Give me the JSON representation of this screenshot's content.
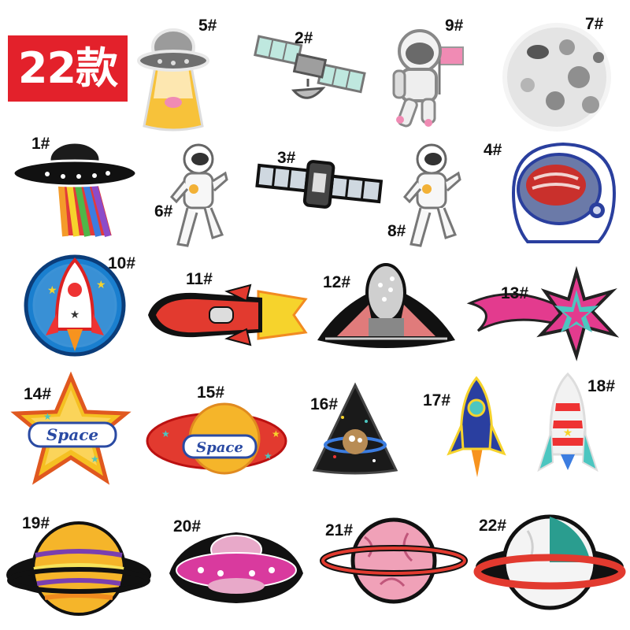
{
  "badge": {
    "text": "22款"
  },
  "patches": [
    {
      "id": "1",
      "label": "1#",
      "icon": "ufo-rainbow-beam"
    },
    {
      "id": "2",
      "label": "2#",
      "icon": "satellite-teal"
    },
    {
      "id": "3",
      "label": "3#",
      "icon": "satellite-dark"
    },
    {
      "id": "4",
      "label": "4#",
      "icon": "astronaut-helmet"
    },
    {
      "id": "5",
      "label": "5#",
      "icon": "ufo-beam-pig"
    },
    {
      "id": "6",
      "label": "6#",
      "icon": "astronaut-floating"
    },
    {
      "id": "7",
      "label": "7#",
      "icon": "moon"
    },
    {
      "id": "8",
      "label": "8#",
      "icon": "astronaut-floating"
    },
    {
      "id": "9",
      "label": "9#",
      "icon": "astronaut-flag"
    },
    {
      "id": "10",
      "label": "10#",
      "icon": "rocket-circle"
    },
    {
      "id": "11",
      "label": "11#",
      "icon": "red-rocket-flying"
    },
    {
      "id": "12",
      "label": "12#",
      "icon": "sequin-spaceship"
    },
    {
      "id": "13",
      "label": "13#",
      "icon": "shooting-star"
    },
    {
      "id": "14",
      "label": "14#",
      "icon": "star-space",
      "text": "Space"
    },
    {
      "id": "15",
      "label": "15#",
      "icon": "planet-space",
      "text": "Space"
    },
    {
      "id": "16",
      "label": "16#",
      "icon": "triangle-planet"
    },
    {
      "id": "17",
      "label": "17#",
      "icon": "blue-rocket"
    },
    {
      "id": "18",
      "label": "18#",
      "icon": "striped-rocket"
    },
    {
      "id": "19",
      "label": "19#",
      "icon": "striped-saturn"
    },
    {
      "id": "20",
      "label": "20#",
      "icon": "pink-ufo"
    },
    {
      "id": "21",
      "label": "21#",
      "icon": "pink-planet"
    },
    {
      "id": "22",
      "label": "22#",
      "icon": "teal-saturn"
    }
  ]
}
